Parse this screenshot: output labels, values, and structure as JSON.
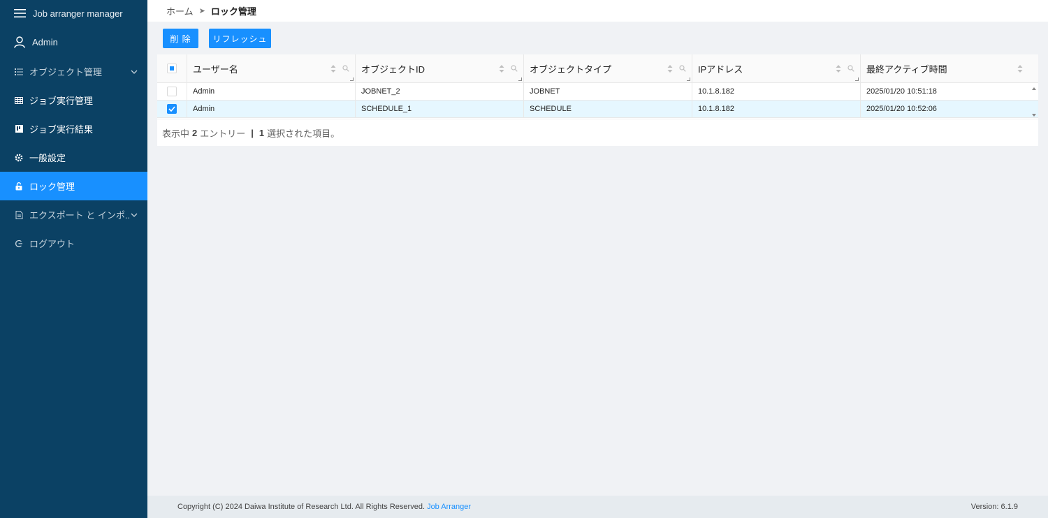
{
  "app": {
    "title": "Job arranger manager"
  },
  "user": {
    "name": "Admin"
  },
  "sidebar": {
    "items": [
      {
        "label": "オブジェクト管理",
        "icon": "list-icon",
        "has_arrow": true
      },
      {
        "label": "ジョブ実行管理",
        "icon": "table-icon",
        "has_arrow": false
      },
      {
        "label": "ジョブ実行結果",
        "icon": "board-icon",
        "has_arrow": false
      },
      {
        "label": "一般設定",
        "icon": "gear-icon",
        "has_arrow": false
      },
      {
        "label": "ロック管理",
        "icon": "lock-icon",
        "has_arrow": false,
        "active": true
      },
      {
        "label": "エクスポート と インポ...",
        "icon": "file-icon",
        "has_arrow": true
      },
      {
        "label": "ログアウト",
        "icon": "logout-icon",
        "has_arrow": false
      }
    ]
  },
  "breadcrumb": {
    "home": "ホーム",
    "separator": "➤",
    "current": "ロック管理"
  },
  "toolbar": {
    "delete_label": "削 除",
    "refresh_label": "リフレッシュ"
  },
  "table": {
    "columns": [
      "ユーザー名",
      "オブジェクトID",
      "オブジェクトタイプ",
      "IPアドレス",
      "最終アクティブ時間"
    ],
    "rows": [
      {
        "checked": false,
        "user": "Admin",
        "object_id": "JOBNET_2",
        "object_type": "JOBNET",
        "ip": "10.1.8.182",
        "last_active": "2025/01/20 10:51:18"
      },
      {
        "checked": true,
        "user": "Admin",
        "object_id": "SCHEDULE_1",
        "object_type": "SCHEDULE",
        "ip": "10.1.8.182",
        "last_active": "2025/01/20 10:52:06"
      }
    ],
    "summary": {
      "prefix": "表示中",
      "count": "2",
      "entries": "エントリー",
      "divider": "|",
      "selected_count": "1",
      "selected_text": "選択された項目。"
    }
  },
  "footer": {
    "copyright": "Copyright (C) 2024 Daiwa Institute of Research Ltd. All Rights Reserved.",
    "link": "Job Arranger",
    "version": "Version: 6.1.9"
  },
  "colors": {
    "sidebar": "#0b4164",
    "accent": "#1890ff",
    "background": "#f0f2f5"
  }
}
